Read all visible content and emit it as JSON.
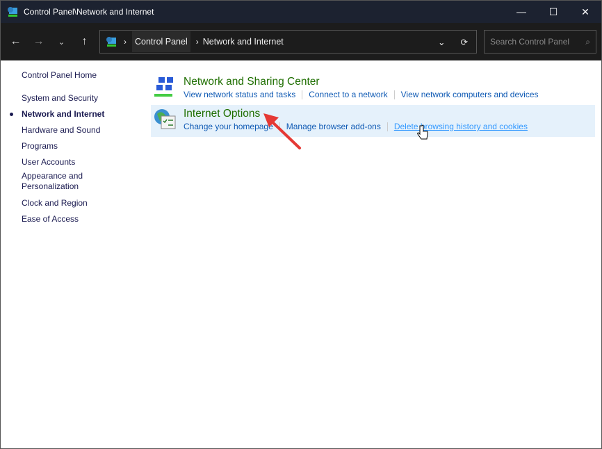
{
  "window": {
    "title": "Control Panel\\Network and Internet"
  },
  "address": {
    "crumbs": [
      "Control Panel",
      "Network and Internet"
    ]
  },
  "search": {
    "placeholder": "Search Control Panel"
  },
  "sidebar": {
    "home": "Control Panel Home",
    "items": [
      {
        "label": "System and Security"
      },
      {
        "label": "Network and Internet",
        "current": true
      },
      {
        "label": "Hardware and Sound"
      },
      {
        "label": "Programs"
      },
      {
        "label": "User Accounts"
      },
      {
        "label": "Appearance and Personalization"
      },
      {
        "label": "Clock and Region"
      },
      {
        "label": "Ease of Access"
      }
    ]
  },
  "categories": [
    {
      "title": "Network and Sharing Center",
      "icon": "network-icon",
      "links": [
        "View network status and tasks",
        "Connect to a network",
        "View network computers and devices"
      ]
    },
    {
      "title": "Internet Options",
      "icon": "internet-options-icon",
      "links": [
        "Change your homepage",
        "Manage browser add-ons",
        "Delete browsing history and cookies"
      ]
    }
  ],
  "colors": {
    "title_bar": "#1c2230",
    "category_title": "#1e6e00",
    "link": "#0f5ab4",
    "highlight": "#e5f1fb",
    "arrow": "#e53935"
  }
}
